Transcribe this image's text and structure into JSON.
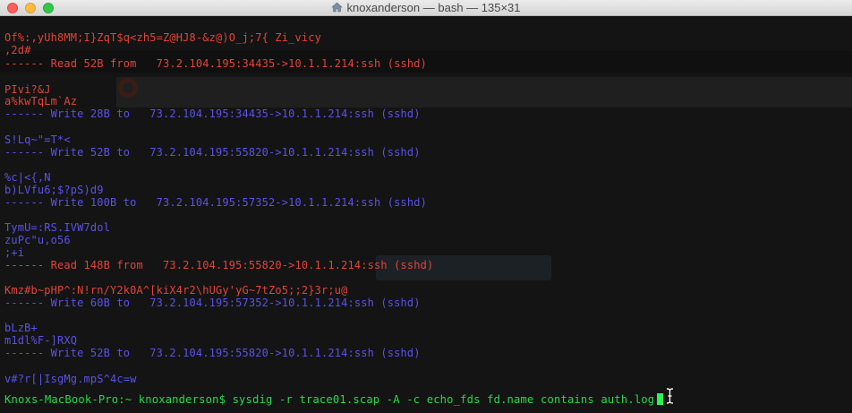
{
  "window": {
    "title": "knoxanderson — bash — 135×31",
    "title_icon": "home-icon"
  },
  "colors": {
    "read": "#e1443a",
    "write": "#5a52e8",
    "prompt": "#25d94c",
    "background": "#141414"
  },
  "terminal": {
    "lines": [
      {
        "text": "Of%:,yUh8MM;I}ZqT$q<zh5=Z@HJ8-&z@)O_j;7{ Zi_vicy",
        "color": "red"
      },
      {
        "text": ",2d#",
        "color": "red"
      },
      {
        "text": "------ Read 52B from   73.2.104.195:34435->10.1.1.214:ssh (sshd)",
        "color": "red"
      },
      {
        "text": "PIvi?&J",
        "color": "red"
      },
      {
        "text": "a%kwTqLm`Az",
        "color": "red"
      },
      {
        "text": "------ Write 28B to   73.2.104.195:34435->10.1.1.214:ssh (sshd)",
        "color": "blue"
      },
      {
        "text": "S!Lq~\"=T*<",
        "color": "blue"
      },
      {
        "text": "------ Write 52B to   73.2.104.195:55820->10.1.1.214:ssh (sshd)",
        "color": "blue"
      },
      {
        "text": "%c|<{,N",
        "color": "blue"
      },
      {
        "text": "b)LVfu6;$?pS)d9",
        "color": "blue"
      },
      {
        "text": "------ Write 100B to   73.2.104.195:57352->10.1.1.214:ssh (sshd)",
        "color": "blue"
      },
      {
        "text": "TymU=:RS.IVW7dol",
        "color": "blue"
      },
      {
        "text": "zuPc\"u,o56",
        "color": "blue"
      },
      {
        "text": ";+i",
        "color": "blue"
      },
      {
        "text": "------ Read 148B from   73.2.104.195:55820->10.1.1.214:ssh (sshd)",
        "color": "red"
      },
      {
        "text": "Kmz#b~pHP^:N!rn/Y2k0A^[kiX4r2\\hUGy'yG~7tZo5;;2}3r;u@",
        "color": "red"
      },
      {
        "text": "------ Write 60B to   73.2.104.195:57352->10.1.1.214:ssh (sshd)",
        "color": "blue"
      },
      {
        "text": "bLzB+",
        "color": "blue"
      },
      {
        "text": "m1dl%F-]RXQ",
        "color": "blue"
      },
      {
        "text": "------ Write 52B to   73.2.104.195:55820->10.1.1.214:ssh (sshd)",
        "color": "blue"
      },
      {
        "text": "v#?r[|IsgMg.mpS^4c=w",
        "color": "blue"
      }
    ],
    "prompt": "Knoxs-MacBook-Pro:~ knoxanderson$ sysdig -r trace01.scap -A -c echo_fds fd.name contains auth.log"
  }
}
